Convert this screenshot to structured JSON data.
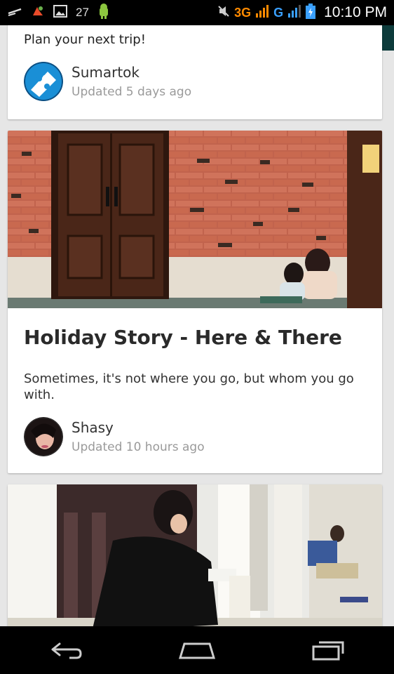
{
  "status_bar": {
    "notification_count": "27",
    "network_3g": "3G",
    "network_g": "G",
    "time": "10:10 PM"
  },
  "stories": [
    {
      "teaser": "Plan your next trip!",
      "author": "Sumartok",
      "updated": "Updated 5 days ago"
    },
    {
      "title": "Holiday Story - Here & There",
      "description": "Sometimes, it's not where you go, but whom you go with.",
      "author": "Shasy",
      "updated": "Updated 10 hours ago"
    }
  ],
  "colors": {
    "brick": "#b85a47",
    "door": "#4a2618",
    "accent_3g": "#ff8a00",
    "accent_g": "#3aa0ff"
  }
}
